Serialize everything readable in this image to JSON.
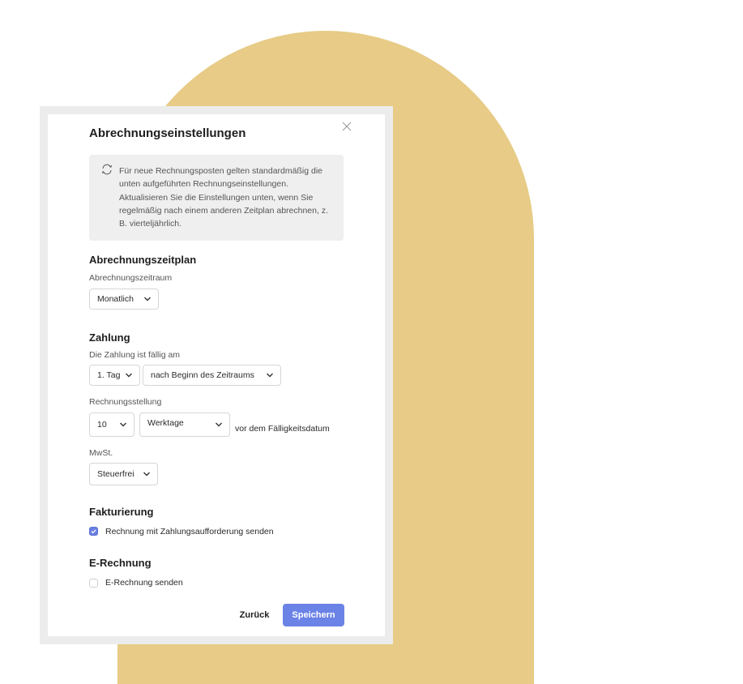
{
  "dialog": {
    "title": "Abrechnungseinstellungen",
    "info_text": "Für neue Rechnungsposten gelten standardmäßig die unten aufgeführten Rechnungseinstellungen. Aktualisieren Sie die Einstellungen unten, wenn Sie regelmäßig nach einem anderen Zeitplan abrechnen, z. B. vierteljährlich."
  },
  "schedule": {
    "heading": "Abrechnungszeitplan",
    "period_label": "Abrechnungszeitraum",
    "period_value": "Monatlich"
  },
  "payment": {
    "heading": "Zahlung",
    "due_label": "Die Zahlung ist fällig am",
    "due_day_value": "1. Tag",
    "due_relative_value": "nach Beginn des Zeitraums",
    "invoicing_label": "Rechnungsstellung",
    "invoicing_count_value": "10",
    "invoicing_unit_value": "Werktage",
    "invoicing_suffix": "vor dem Fälligkeitsdatum",
    "vat_label": "MwSt.",
    "vat_value": "Steuerfrei"
  },
  "billing": {
    "heading": "Fakturierung",
    "checkbox_label": "Rechnung mit Zahlungsaufforderung senden",
    "checked": true
  },
  "einvoice": {
    "heading": "E-Rechnung",
    "checkbox_label": "E-Rechnung senden",
    "checked": false
  },
  "actions": {
    "back_label": "Zurück",
    "save_label": "Speichern"
  },
  "colors": {
    "accent": "#6b82e6",
    "background_shape": "#e7cb86"
  }
}
